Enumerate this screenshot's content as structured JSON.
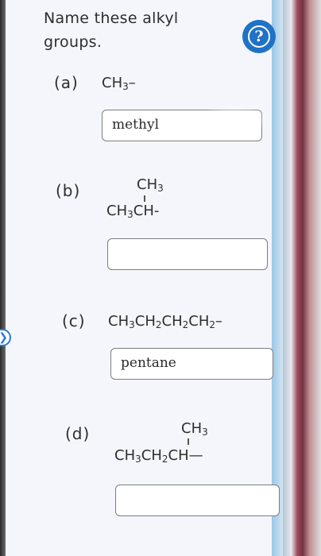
{
  "question": {
    "prompt": "Name these alkyl groups."
  },
  "items": [
    {
      "label": "(a)",
      "formula_main": [
        "CH",
        "3",
        "–"
      ],
      "answer": "methyl"
    },
    {
      "label": "(b)",
      "formula_branch": [
        "CH",
        "3"
      ],
      "formula_main": [
        "CH",
        "3",
        "CH-"
      ],
      "answer": ""
    },
    {
      "label": "(c)",
      "formula_main": [
        "CH",
        "3",
        "CH",
        "2",
        "CH",
        "2",
        "CH",
        "2",
        "–"
      ],
      "answer": "pentane"
    },
    {
      "label": "(d)",
      "formula_branch": [
        "CH",
        "3"
      ],
      "formula_main": [
        "CH",
        "3",
        "CH",
        "2",
        "CH—"
      ],
      "answer": ""
    }
  ],
  "help_icon": "question-circle-icon",
  "side_icon": "chevron-right-icon",
  "colors": {
    "accent": "#1f72c6",
    "text": "#2e2e2e",
    "input_border": "#7d7d7d"
  }
}
